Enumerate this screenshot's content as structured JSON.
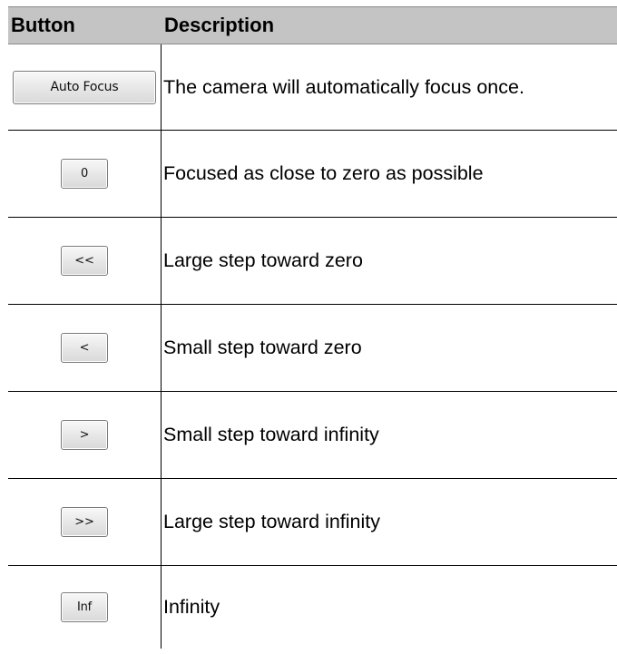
{
  "table": {
    "headers": {
      "button": "Button",
      "description": "Description"
    },
    "rows": [
      {
        "button_label": "Auto Focus",
        "description": "The camera will automatically focus once."
      },
      {
        "button_label": "0",
        "description": "Focused as close to zero as possible"
      },
      {
        "button_label": "<<",
        "description": "Large step toward zero"
      },
      {
        "button_label": "<",
        "description": "Small step toward zero"
      },
      {
        "button_label": ">",
        "description": "Small step toward infinity"
      },
      {
        "button_label": ">>",
        "description": "Large step toward infinity"
      },
      {
        "button_label": "Inf",
        "description": "Infinity"
      }
    ]
  }
}
